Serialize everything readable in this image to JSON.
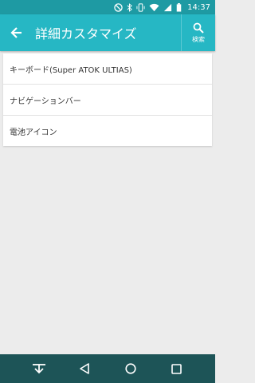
{
  "status_bar": {
    "time": "14:37",
    "icons": [
      "do-not-disturb-icon",
      "bluetooth-icon",
      "vibrate-icon",
      "wifi-icon",
      "signal-icon",
      "battery-icon"
    ]
  },
  "app_bar": {
    "title": "詳細カスタマイズ",
    "search_label": "検索"
  },
  "settings_list": [
    {
      "label": "キーボード(Super ATOK ULTIAS)"
    },
    {
      "label": "ナビゲーションバー"
    },
    {
      "label": "電池アイコン"
    }
  ],
  "nav_bar": {
    "buttons": [
      "keyboard-hide-icon",
      "back-icon",
      "home-icon",
      "recents-icon"
    ]
  },
  "colors": {
    "status_bar": "#1e9aa3",
    "app_bar": "#26b7c4",
    "nav_bar": "#1d5457",
    "background": "#ececec"
  }
}
